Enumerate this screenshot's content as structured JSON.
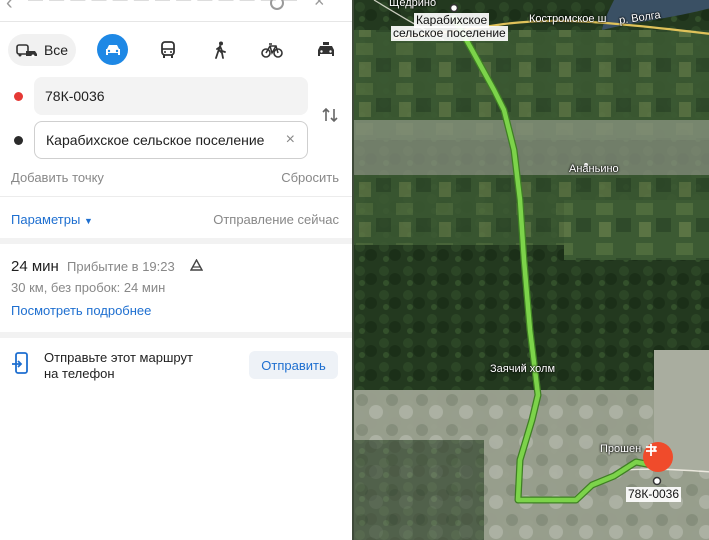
{
  "modes": {
    "all_label": "Все",
    "items": [
      {
        "name": "all",
        "icon": "all-transport-icon"
      },
      {
        "name": "car",
        "icon": "car-icon",
        "selected": true
      },
      {
        "name": "bus",
        "icon": "bus-icon"
      },
      {
        "name": "walk",
        "icon": "pedestrian-icon"
      },
      {
        "name": "bike",
        "icon": "bicycle-icon"
      },
      {
        "name": "taxi",
        "icon": "taxi-icon"
      }
    ]
  },
  "route_points": {
    "from": {
      "value": "78К-0036",
      "dot_color": "#e53935"
    },
    "to": {
      "value": "Карабихское сельское поселение",
      "dot_color": "#2b2b2b"
    }
  },
  "actions": {
    "add_point": "Добавить точку",
    "reset": "Сбросить",
    "parameters": "Параметры",
    "departure": "Отправление сейчас"
  },
  "route": {
    "duration": "24 мин",
    "arrival": "Прибытие в 19:23",
    "distance": "30 км, без пробок: 24 мин",
    "details_link": "Посмотреть подробнее"
  },
  "send": {
    "text_line1": "Отправьте этот маршрут",
    "text_line2": "на телефон",
    "button": "Отправить"
  },
  "map": {
    "labels": {
      "start_line1": "Карабихское",
      "start_line2": "сельское поселение",
      "river": "р. Волга",
      "top_village": "Щедрино",
      "kostromskoe": "Костромское ш",
      "ananino": "Ананьино",
      "hill": "Заячий холм",
      "proshen": "Прошен",
      "end_road": "78К-0036"
    },
    "route_color": "#7cd34a"
  },
  "colors": {
    "accent": "#1e6fd0",
    "selected_mode": "#1e88e5",
    "destination_marker": "#f04b2b"
  }
}
